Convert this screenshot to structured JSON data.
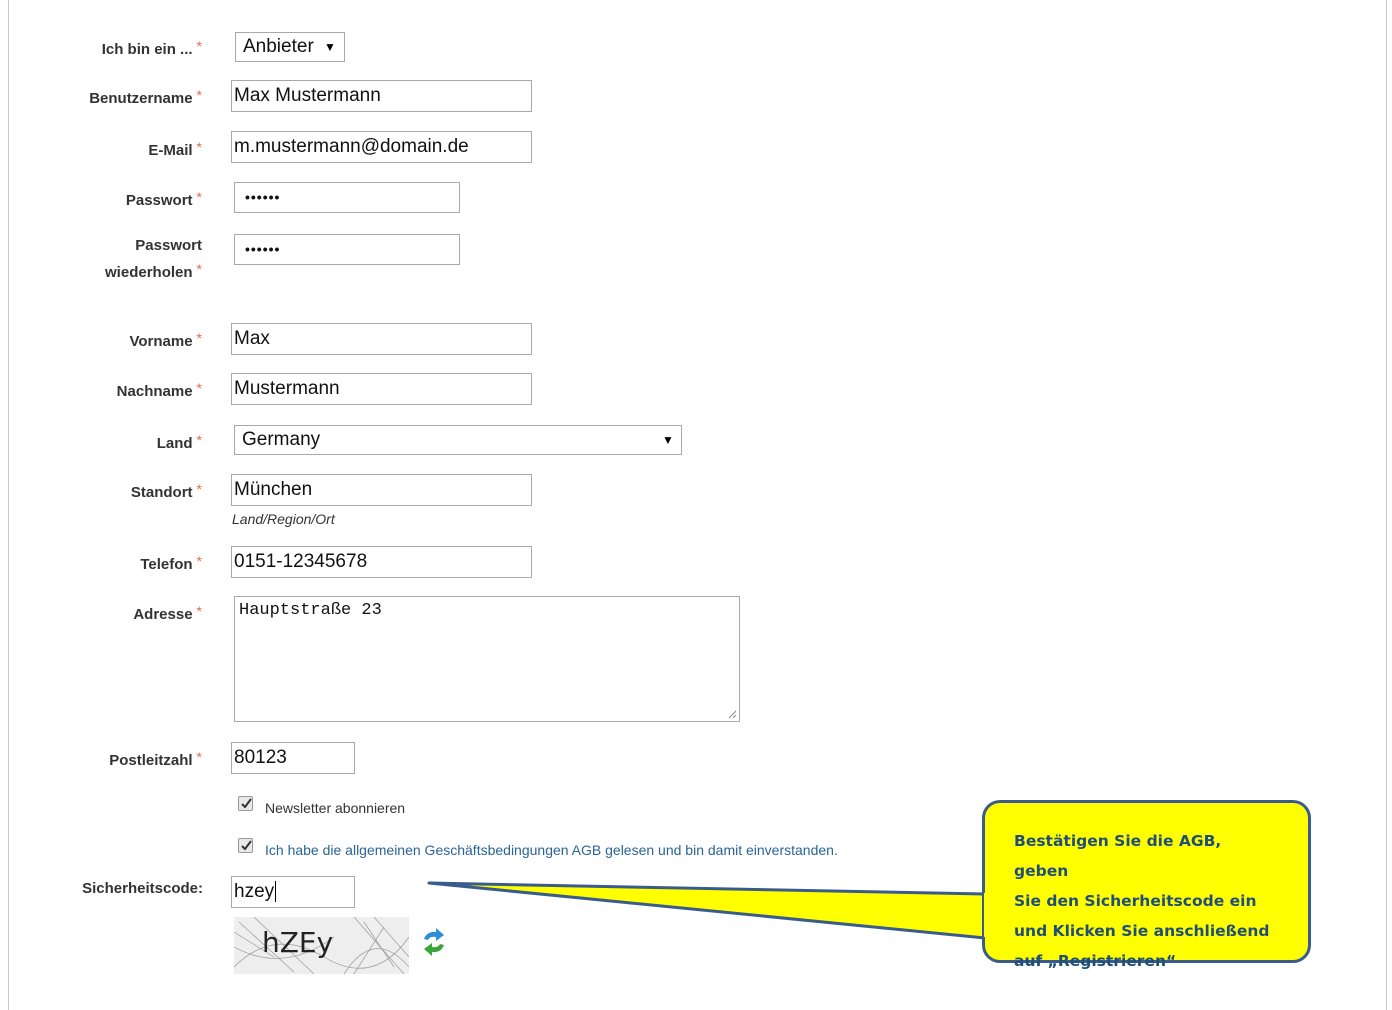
{
  "required_mark": "*",
  "fields": {
    "role": {
      "label": "Ich bin ein ...",
      "value": "Anbieter"
    },
    "username": {
      "label": "Benutzername",
      "value": "Max Mustermann"
    },
    "email": {
      "label": "E-Mail",
      "value": "m.mustermann@domain.de"
    },
    "password": {
      "label": "Passwort",
      "value": "••••••"
    },
    "password2": {
      "label_line1": "Passwort",
      "label_line2": "wiederholen",
      "value": "••••••"
    },
    "firstname": {
      "label": "Vorname",
      "value": "Max"
    },
    "lastname": {
      "label": "Nachname",
      "value": "Mustermann"
    },
    "country": {
      "label": "Land",
      "value": "Germany"
    },
    "location": {
      "label": "Standort",
      "value": "München",
      "hint": "Land/Region/Ort"
    },
    "phone": {
      "label": "Telefon",
      "value": "0151-12345678"
    },
    "address": {
      "label": "Adresse",
      "value": "Hauptstraße 23"
    },
    "zip": {
      "label": "Postleitzahl",
      "value": "80123"
    },
    "newsletter": {
      "label": "Newsletter abonnieren",
      "checked": true
    },
    "terms": {
      "label": "Ich habe die allgemeinen Geschäftsbedingungen AGB gelesen und bin damit einverstanden.",
      "checked": true
    },
    "captcha": {
      "label": "Sicherheitscode:",
      "value": "hzey",
      "image_text": "hZEy"
    }
  },
  "icons": {
    "select_caret": "caret-down-icon",
    "refresh": "refresh-captcha-icon",
    "checkmark": "checkmark-icon"
  },
  "callout": {
    "lines": [
      "Bestätigen Sie die AGB, geben",
      "Sie den Sicherheitscode ein",
      "und Klicken Sie anschließend",
      "auf „Registrieren“"
    ]
  },
  "colors": {
    "required": "#e26a4a",
    "callout_bg": "#ffff00",
    "callout_border": "#3a5c8c",
    "callout_text": "#1f4e79",
    "link": "#2a6496"
  }
}
